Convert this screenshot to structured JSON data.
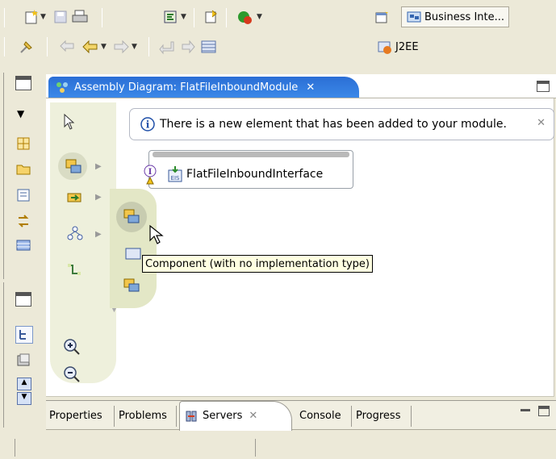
{
  "toolbar": {
    "perspectives": {
      "business": "Business Inte...",
      "j2ee": "J2EE"
    }
  },
  "editor": {
    "tab_title": "Assembly Diagram: FlatFileInboundModule",
    "tab_close": "✕",
    "notification": {
      "icon": "info-icon",
      "text": "There is a new element that has been added to your module.",
      "close": "✕"
    },
    "interface_box": {
      "label": "FlatFileInboundInterface",
      "eis_tag": "EIS"
    },
    "tooltip": "Component (with no implementation type)"
  },
  "bottom_tabs": [
    {
      "label": "Properties"
    },
    {
      "label": "Problems"
    },
    {
      "label": "Servers",
      "close": "✕"
    },
    {
      "label": "Console"
    },
    {
      "label": "Progress"
    }
  ],
  "colors": {
    "tab_active": "#2b6ed5",
    "tooltip_bg": "#ffffe1",
    "palette_bg": "#eef0dc"
  }
}
